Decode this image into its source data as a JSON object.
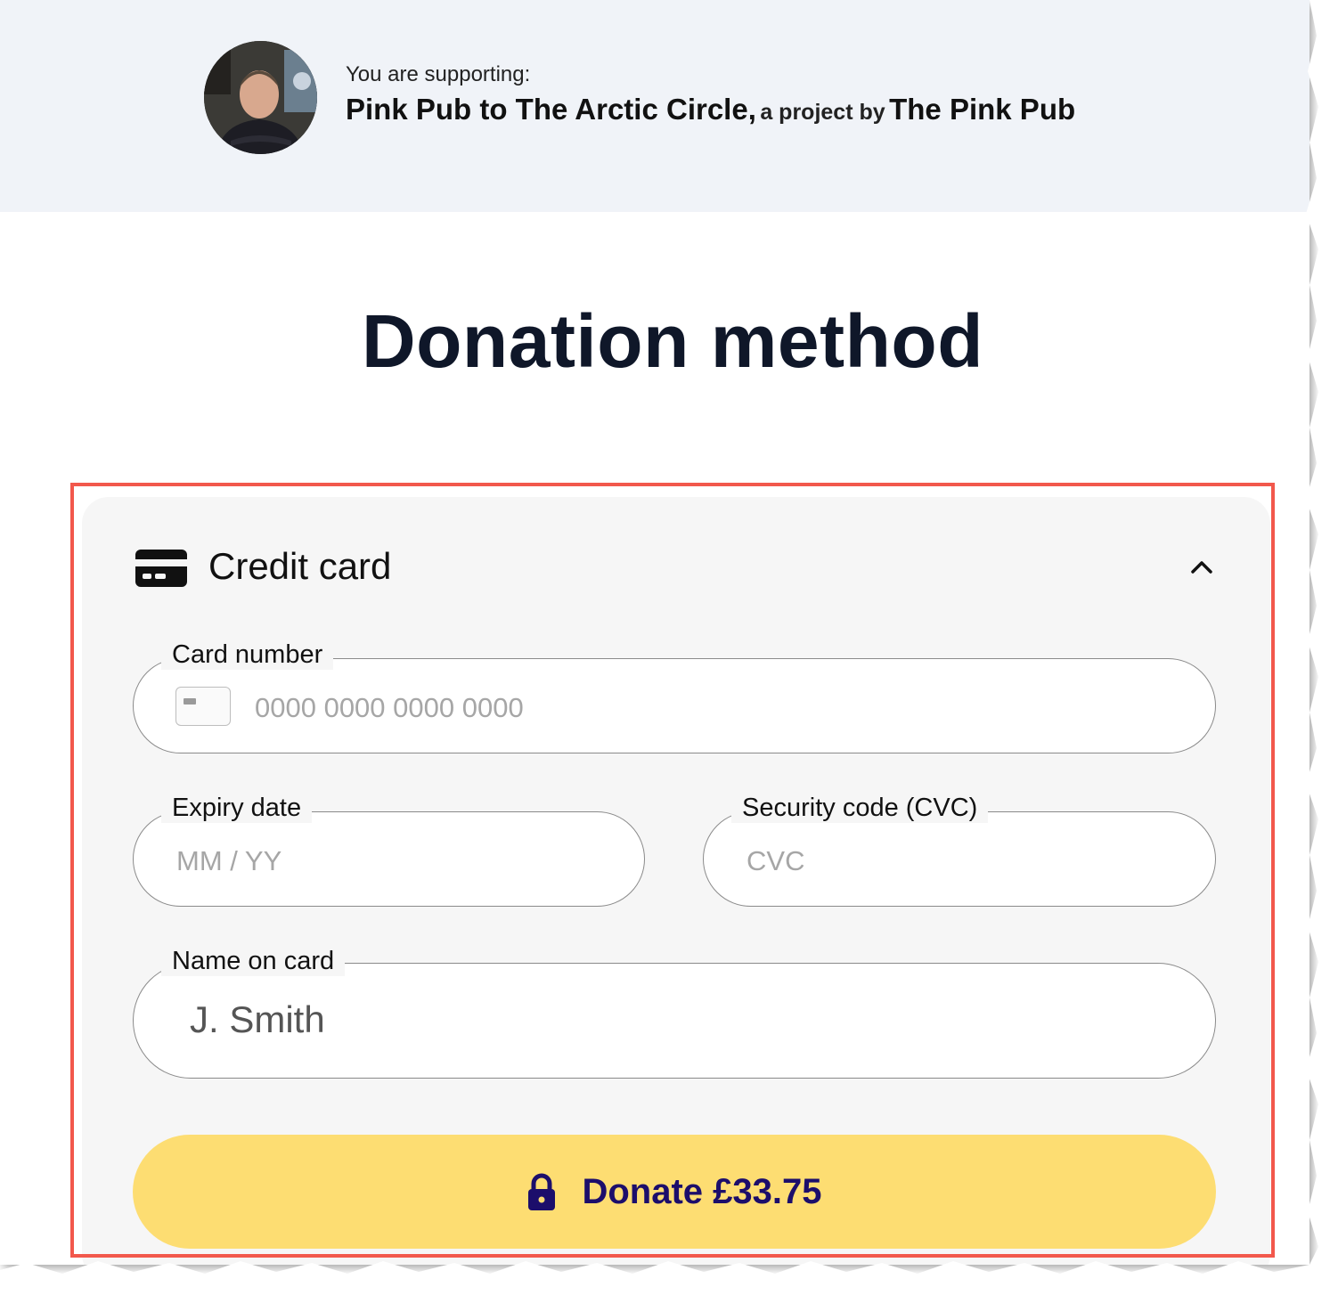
{
  "header": {
    "support_label": "You are supporting:",
    "project_name": "Pink Pub to The Arctic Circle,",
    "by_text": "a project by",
    "owner_name": "The Pink Pub"
  },
  "page_title": "Donation method",
  "payment": {
    "method_title": "Credit card",
    "card_number": {
      "label": "Card number",
      "placeholder": "0000 0000 0000 0000"
    },
    "expiry": {
      "label": "Expiry date",
      "placeholder": "MM / YY"
    },
    "cvc": {
      "label": "Security code (CVC)",
      "placeholder": "CVC"
    },
    "name": {
      "label": "Name on card",
      "value": "J. Smith"
    },
    "donate_label": "Donate £33.75"
  },
  "colors": {
    "header_bg": "#f0f3f8",
    "highlight_border": "#f2584c",
    "donate_bg": "#fddd72",
    "donate_text": "#1c0e6b"
  },
  "icons": [
    "avatar-photo",
    "credit-card-icon",
    "chevron-up-icon",
    "card-brand-icon",
    "lock-icon"
  ]
}
